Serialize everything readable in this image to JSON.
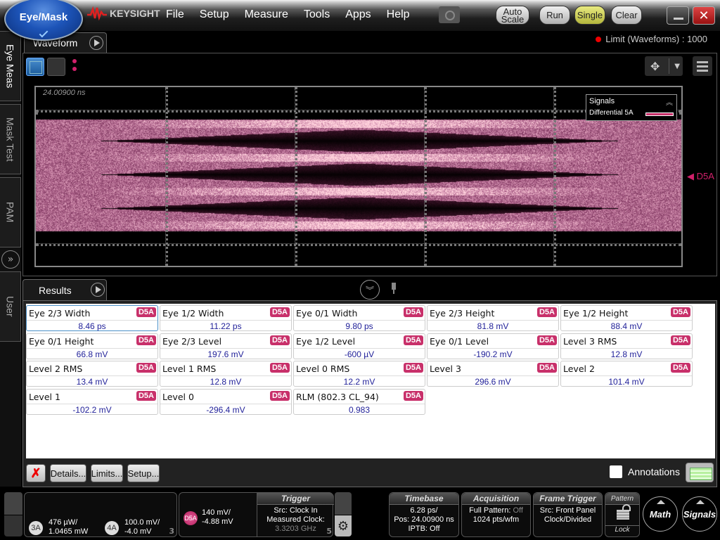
{
  "app": {
    "mode_button": "Eye/Mask",
    "brand": "KEYSIGHT"
  },
  "menu": [
    "File",
    "Setup",
    "Measure",
    "Tools",
    "Apps",
    "Help"
  ],
  "toolbar": {
    "autoscale_line1": "Auto",
    "autoscale_line2": "Scale",
    "run": "Run",
    "single": "Single",
    "clear": "Clear",
    "close": "✕"
  },
  "side_tabs": [
    "Eye Meas",
    "Mask Test",
    "PAM",
    "User"
  ],
  "waveform": {
    "tab_label": "Waveform",
    "limit_text": "Limit (Waveforms) : 1000",
    "timestamp": "24.00900 ns",
    "legend_title": "Signals",
    "legend_signal": "Differential 5A",
    "marker": "◀ D5A",
    "signal_color": "#c8306a"
  },
  "results": {
    "tab_label": "Results",
    "badge": "D5A",
    "rows": [
      [
        {
          "name": "Eye 2/3 Width",
          "value": "8.46 ps"
        },
        {
          "name": "Eye 1/2 Width",
          "value": "11.22 ps"
        },
        {
          "name": "Eye 0/1 Width",
          "value": "9.80 ps"
        },
        {
          "name": "Eye 2/3 Height",
          "value": "81.8 mV"
        },
        {
          "name": "Eye 1/2 Height",
          "value": "88.4 mV"
        }
      ],
      [
        {
          "name": "Eye 0/1 Height",
          "value": "66.8 mV"
        },
        {
          "name": "Eye 2/3 Level",
          "value": "197.6 mV"
        },
        {
          "name": "Eye 1/2 Level",
          "value": "-600 µV"
        },
        {
          "name": "Eye 0/1 Level",
          "value": "-190.2 mV"
        },
        {
          "name": "Level 3 RMS",
          "value": "12.8 mV"
        }
      ],
      [
        {
          "name": "Level 2 RMS",
          "value": "13.4 mV"
        },
        {
          "name": "Level 1 RMS",
          "value": "12.8 mV"
        },
        {
          "name": "Level 0 RMS",
          "value": "12.2 mV"
        },
        {
          "name": "Level 3",
          "value": "296.6 mV"
        },
        {
          "name": "Level 2",
          "value": "101.4 mV"
        }
      ],
      [
        {
          "name": "Level 1",
          "value": "-102.2 mV"
        },
        {
          "name": "Level 0",
          "value": "-296.4 mV"
        },
        {
          "name": "RLM (802.3 CL_94)",
          "value": "0.983"
        }
      ]
    ],
    "buttons": {
      "delete": "✗",
      "details": "Details...",
      "limits": "Limits...",
      "setup": "Setup..."
    },
    "annotations_label": "Annotations"
  },
  "bottom": {
    "ch3": {
      "chip": "3A",
      "line1": "476 µW/",
      "line2": "1.0465 mW"
    },
    "ch4": {
      "chip": "4A",
      "line1": "100.0 mV/",
      "line2": "-4.0 mV"
    },
    "panel_num_1": "3",
    "d5a": {
      "chip": "D5A",
      "line1": "140 mV/",
      "line2": "-4.88 mV"
    },
    "trigger": {
      "title": "Trigger",
      "line1": "Src: Clock In",
      "line2": "Measured Clock:",
      "line3": "3.3203 GHz",
      "num": "5"
    },
    "timebase": {
      "title": "Timebase",
      "line1": "6.28 ps/",
      "line2": "Pos: 24.00900 ns",
      "line3": "IPTB: Off"
    },
    "acquisition": {
      "title": "Acquisition",
      "line1a": "Full Pattern: ",
      "line1b": "Off",
      "line2": "1024 pts/wfm"
    },
    "frame_trigger": {
      "title": "Frame Trigger",
      "line1": "Src: Front Panel",
      "line2": "Clock/Divided"
    },
    "pattern_lock": {
      "top": "Pattern",
      "bottom": "Lock"
    },
    "math": "Math",
    "signals": "Signals"
  }
}
